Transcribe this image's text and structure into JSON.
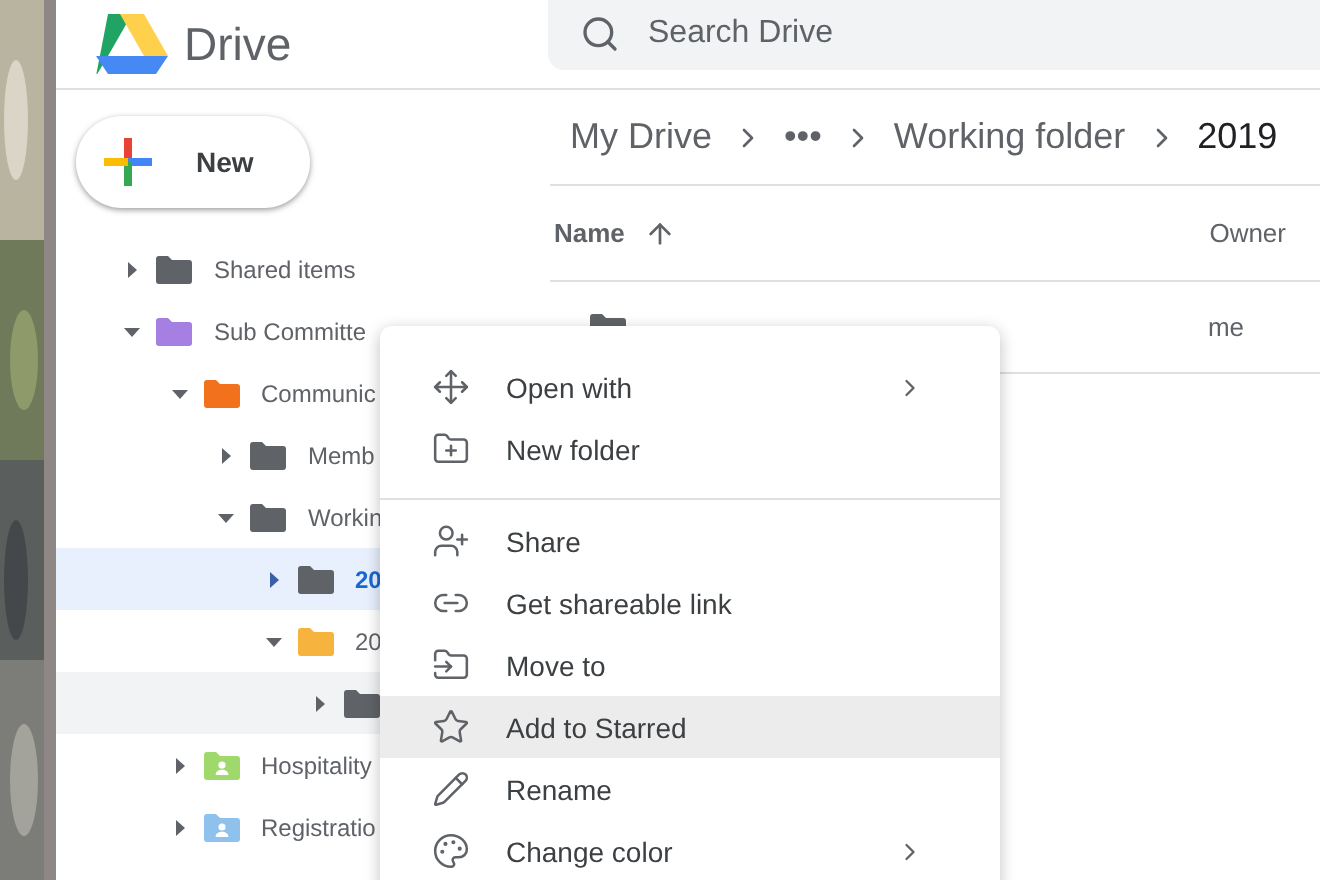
{
  "app": {
    "name": "Drive"
  },
  "search": {
    "placeholder": "Search Drive"
  },
  "new_button": {
    "label": "New"
  },
  "tree": [
    {
      "label": "Shared items",
      "color": "#5f6368",
      "shared": false,
      "expanded": false,
      "selected": false,
      "hovered": false
    },
    {
      "label": "Sub Committe",
      "color": "#a67fe3",
      "shared": false,
      "expanded": true,
      "selected": false,
      "hovered": false,
      "children": [
        {
          "label": "Communic",
          "color": "#f2711c",
          "shared": false,
          "expanded": true,
          "selected": false,
          "hovered": false,
          "children": [
            {
              "label": "Memb",
              "color": "#5f6368",
              "shared": false,
              "expanded": false,
              "selected": false,
              "hovered": false
            },
            {
              "label": "Workin",
              "color": "#5f6368",
              "shared": false,
              "expanded": true,
              "selected": false,
              "hovered": false,
              "children": [
                {
                  "label": "20",
                  "color": "#5f6368",
                  "shared": false,
                  "expanded": false,
                  "selected": true,
                  "hovered": false
                },
                {
                  "label": "20",
                  "color": "#f6b33e",
                  "shared": false,
                  "expanded": true,
                  "selected": false,
                  "hovered": false,
                  "children": [
                    {
                      "color": "#5f6368",
                      "shared": false,
                      "expanded": false,
                      "selected": false,
                      "hovered": true
                    }
                  ]
                }
              ]
            }
          ]
        },
        {
          "label": "Hospitality",
          "color": "#9fd86b",
          "shared": true,
          "expanded": false,
          "selected": false,
          "hovered": false
        },
        {
          "label": "Registratio",
          "color": "#8ec1ec",
          "shared": true,
          "expanded": false,
          "selected": false,
          "hovered": false
        }
      ]
    }
  ],
  "breadcrumb": [
    "My Drive",
    "•••",
    "Working folder",
    "2019"
  ],
  "table": {
    "columns": [
      "Name",
      "Owner"
    ],
    "rows": [
      {
        "owner": "me"
      }
    ]
  },
  "menu": {
    "groups": [
      [
        {
          "label": "Open with",
          "submenu": true,
          "highlighted": false
        },
        {
          "label": "New folder",
          "submenu": false,
          "highlighted": false
        }
      ],
      [
        {
          "label": "Share",
          "submenu": false,
          "highlighted": false
        },
        {
          "label": "Get shareable link",
          "submenu": false,
          "highlighted": false
        },
        {
          "label": "Move to",
          "submenu": false,
          "highlighted": false
        },
        {
          "label": "Add to Starred",
          "submenu": false,
          "highlighted": true
        },
        {
          "label": "Rename",
          "submenu": false,
          "highlighted": false
        },
        {
          "label": "Change color",
          "submenu": true,
          "highlighted": false
        }
      ]
    ]
  }
}
